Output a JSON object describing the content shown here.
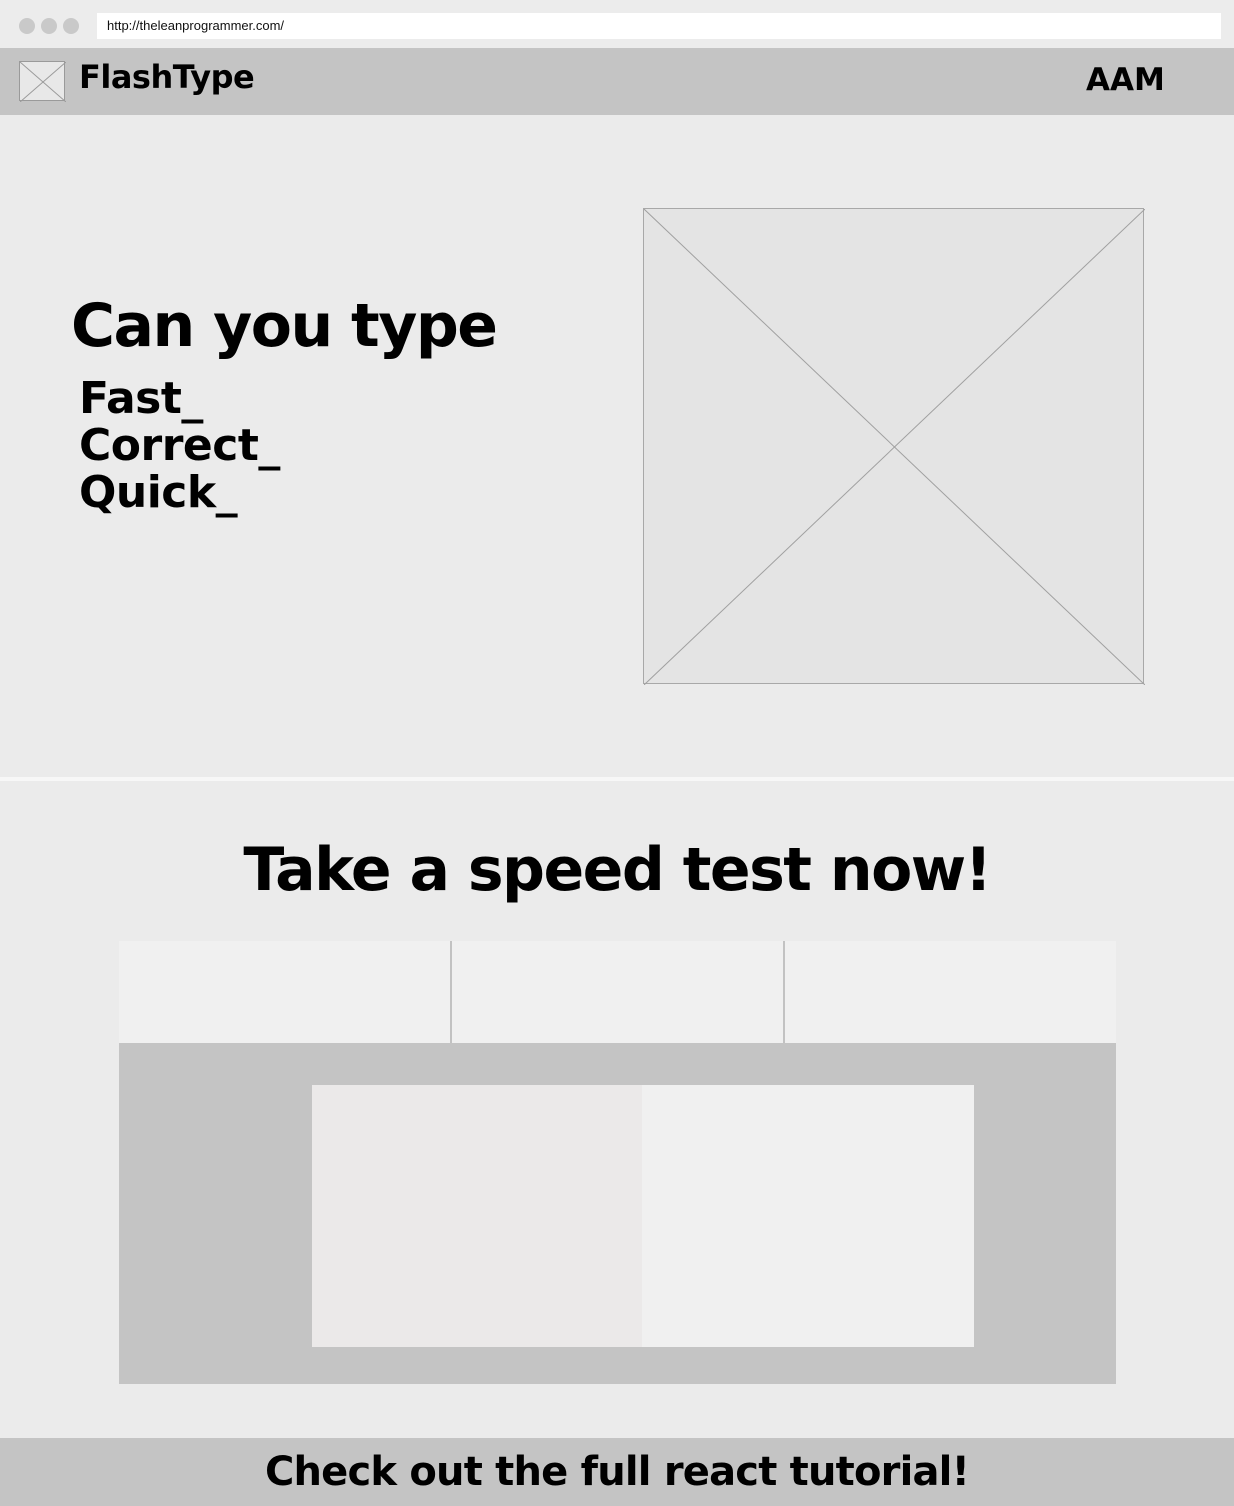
{
  "browser": {
    "url": "http://theleanprogrammer.com/"
  },
  "header": {
    "brand": "FlashType",
    "user": "AAM"
  },
  "hero": {
    "title": "Can you type",
    "words": [
      "Fast_",
      "Correct_",
      "Quick_"
    ]
  },
  "test": {
    "title": "Take a speed test now!"
  },
  "footer": {
    "text": "Check out the full react tutorial!"
  },
  "icons": {
    "logo": "image-placeholder-icon",
    "hero_image": "image-placeholder-icon"
  },
  "colors": {
    "background": "#ebebeb",
    "header": "#c4c4c4",
    "footer": "#c4c4c4",
    "stats_bar": "#f0f0f0",
    "test_box": "#c4c4c4"
  }
}
